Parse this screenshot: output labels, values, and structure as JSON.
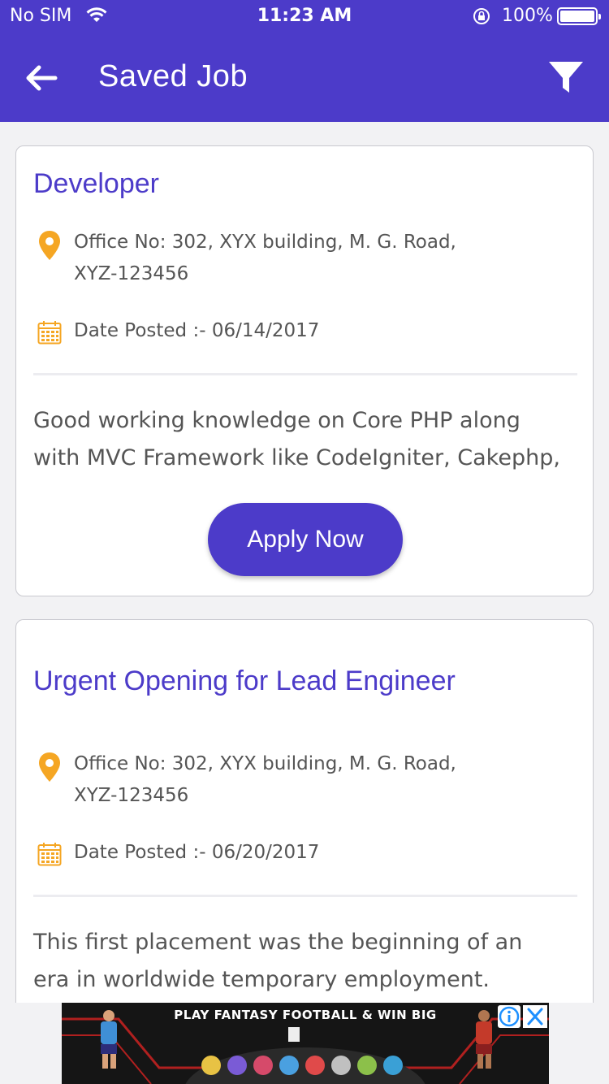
{
  "status_bar": {
    "carrier": "No SIM",
    "time": "11:23 AM",
    "battery_percent": "100%"
  },
  "header": {
    "title": "Saved Job",
    "back_icon": "arrow-left-icon",
    "filter_icon": "filter-icon"
  },
  "jobs": [
    {
      "title": "Developer",
      "address_line1": "Office No: 302, XYX building, M. G. Road,",
      "address_line2": "XYZ-123456",
      "date_posted": "Date Posted :- 06/14/2017",
      "description_line1": "Good working knowledge on Core PHP along",
      "description_line2": "with MVC Framework like CodeIgniter, Cakephp,",
      "apply_label": "Apply Now"
    },
    {
      "title": "Urgent Opening for Lead Engineer",
      "address_line1": "Office No: 302, XYX building, M. G. Road,",
      "address_line2": "XYZ-123456",
      "date_posted": "Date Posted :- 06/20/2017",
      "description_line1": "This first placement was the beginning of an",
      "description_line2": "era in worldwide temporary employment."
    }
  ],
  "ad": {
    "text": "PLAY FANTASY FOOTBALL & WIN BIG"
  },
  "colors": {
    "primary": "#4c3bc9",
    "accent_icon": "#f5a623",
    "background": "#f2f2f4"
  }
}
